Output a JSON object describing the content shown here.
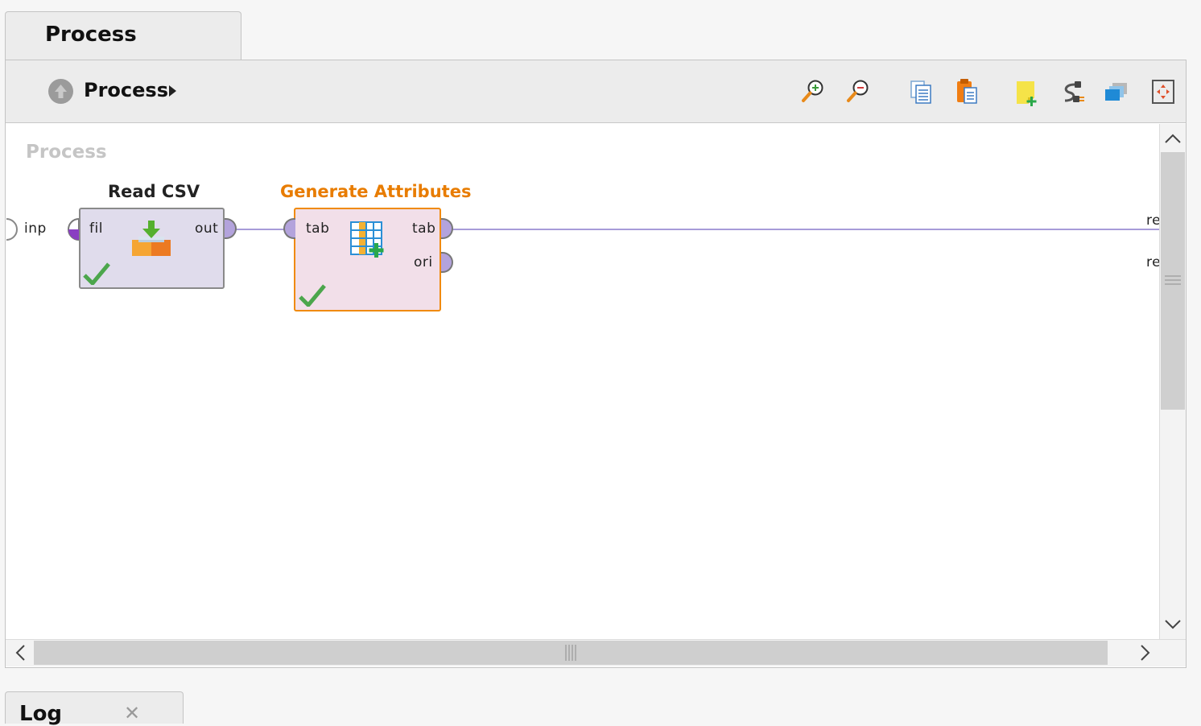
{
  "tabs": {
    "process_label": "Process",
    "log_label": "Log",
    "log_close_glyph": "✕"
  },
  "breadcrumb": {
    "label": "Process"
  },
  "toolbar": {
    "icons": [
      "zoom-in-icon",
      "zoom-out-icon",
      "copy-icon",
      "paste-icon",
      "add-note-icon",
      "connect-icon",
      "layers-icon",
      "fit-view-icon"
    ]
  },
  "canvas": {
    "title": "Process",
    "process_input_port": "inp",
    "result_ports": [
      "re",
      "re"
    ]
  },
  "operators": {
    "read_csv": {
      "title": "Read CSV",
      "in_port": "fil",
      "out_port": "out",
      "status": "ok"
    },
    "generate_attributes": {
      "title": "Generate Attributes",
      "in_port": "tab",
      "out_ports": [
        "tab",
        "ori"
      ],
      "status": "ok",
      "selected": true
    }
  },
  "colors": {
    "selected_accent": "#e87c00",
    "wire": "#a79bd9",
    "check": "#4ca64c"
  }
}
